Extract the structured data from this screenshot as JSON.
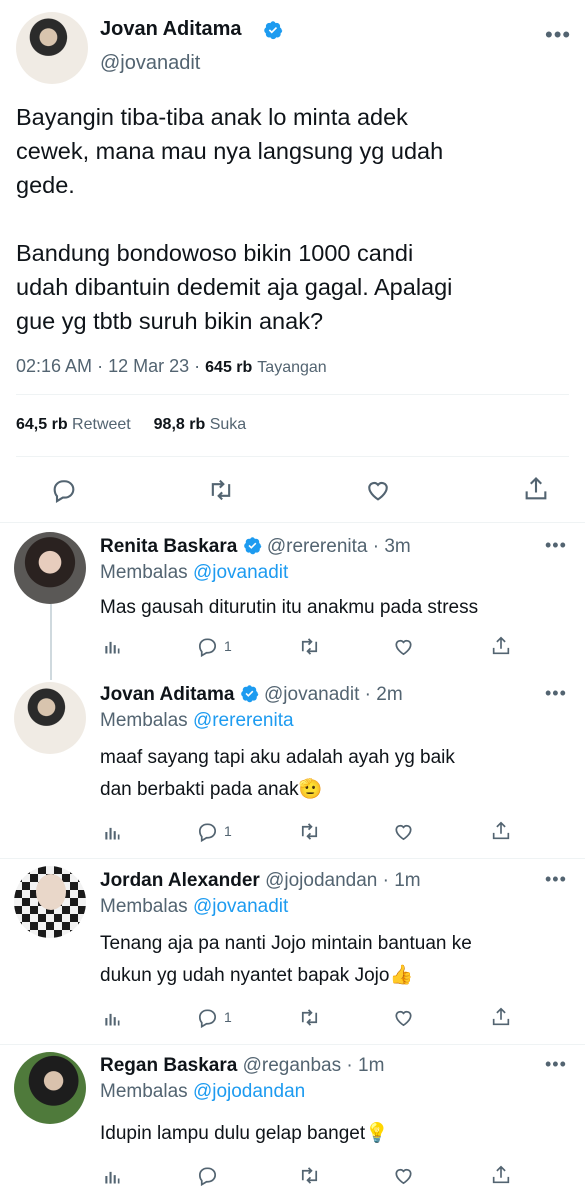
{
  "main_tweet": {
    "author_name": "Jovan Aditama",
    "handle": "@jovanadit",
    "text_lines": [
      "Bayangin tiba-tiba anak lo minta adek",
      "cewek, mana mau nya langsung yg udah",
      "gede.",
      "",
      "Bandung bondowoso bikin 1000 candi",
      "udah dibantuin dedemit aja gagal. Apalagi",
      "gue yg tbtb suruh bikin anak?"
    ],
    "time": "02:16 AM",
    "date": "12 Mar 23",
    "views": "645 rb",
    "views_label": "Tayangan",
    "retweets": "64,5 rb",
    "retweets_label": "Retweet",
    "likes": "98,8 rb",
    "likes_label": "Suka"
  },
  "replies": [
    {
      "name": "Renita Baskara",
      "verified": true,
      "handle": "@rererenita",
      "time": "3m",
      "reply_prefix": "Membalas",
      "reply_to": "@jovanadit",
      "text_lines": [
        "Mas gausah diturutin itu anakmu pada stress"
      ],
      "reply_count": "1"
    },
    {
      "name": "Jovan Aditama",
      "verified": true,
      "handle": "@jovanadit",
      "time": "2m",
      "reply_prefix": "Membalas",
      "reply_to": "@rererenita",
      "text_lines": [
        "maaf sayang tapi aku adalah ayah yg baik",
        "dan berbakti pada anak🫡"
      ],
      "reply_count": "1"
    },
    {
      "name": "Jordan Alexander",
      "verified": false,
      "handle": "@jojodandan",
      "time": "1m",
      "reply_prefix": "Membalas",
      "reply_to": "@jovanadit",
      "text_lines": [
        "Tenang aja pa nanti Jojo mintain bantuan ke",
        "dukun yg udah nyantet bapak Jojo👍"
      ],
      "reply_count": "1"
    },
    {
      "name": "Regan Baskara",
      "verified": false,
      "handle": "@reganbas",
      "time": "1m",
      "reply_prefix": "Membalas",
      "reply_to": "@jojodandan",
      "text_lines": [
        "Idupin lampu dulu gelap banget💡"
      ],
      "reply_count": ""
    }
  ],
  "icons": {
    "more": "more-icon",
    "verified": "verified-badge-icon",
    "reply": "reply-icon",
    "retweet": "retweet-icon",
    "like": "heart-icon",
    "share": "share-icon",
    "views": "analytics-icon"
  },
  "colors": {
    "verified": "#1d9bf0",
    "link": "#1d9bf0",
    "muted": "#536471",
    "text": "#0f1419"
  }
}
